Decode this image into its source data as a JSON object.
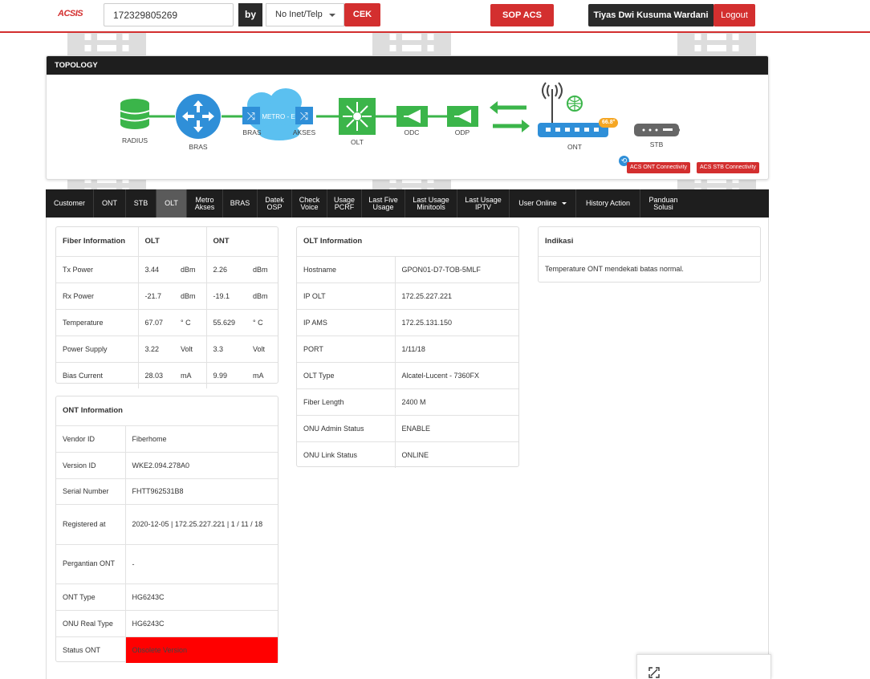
{
  "header": {
    "logo": "ACSIS",
    "search_value": "172329805269",
    "by_label": "by",
    "search_type": "No Inet/Telp",
    "check_button": "CEK",
    "sop_button": "SOP ACS",
    "user_name": "Tiyas Dwi Kusuma Wardani",
    "logout_button": "Logout"
  },
  "topology": {
    "title": "TOPOLOGY",
    "nodes": {
      "radius": "RADIUS",
      "bras": "BRAS",
      "bras_metro": "BRAS",
      "metro": "METRO - E",
      "akses": "AKSES",
      "olt": "OLT",
      "odc": "ODC",
      "odp": "ODP",
      "ont": "ONT",
      "stb": "STB"
    },
    "ont_temperature": "66.8°",
    "acs_ont_button": "ACS ONT Connectivity",
    "acs_stb_button": "ACS STB Connectivity",
    "colors": {
      "green": "#3bb54a",
      "blue": "#2f8fd8",
      "gray": "#666666"
    }
  },
  "tabs": [
    {
      "label": "Customer",
      "active": false
    },
    {
      "label": "ONT",
      "active": false
    },
    {
      "label": "STB",
      "active": false
    },
    {
      "label": "OLT",
      "active": true
    },
    {
      "label": "Metro Akses",
      "active": false
    },
    {
      "label": "BRAS",
      "active": false
    },
    {
      "label": "Datek OSP",
      "active": false
    },
    {
      "label": "Check Voice",
      "active": false
    },
    {
      "label": "Usage PCRF",
      "active": false
    },
    {
      "label": "Last Five Usage",
      "active": false
    },
    {
      "label": "Last Usage Minitools",
      "active": false
    },
    {
      "label": "Last Usage IPTV",
      "active": false
    },
    {
      "label": "User Online",
      "active": false
    },
    {
      "label": "History Action",
      "active": false
    },
    {
      "label": "Panduan Solusi",
      "active": false
    }
  ],
  "fiber_info": {
    "headers": [
      "Fiber Information",
      "OLT",
      "ONT"
    ],
    "rows": [
      {
        "label": "Tx Power",
        "olt": "3.44",
        "olt_unit": "dBm",
        "ont": "2.26",
        "ont_unit": "dBm"
      },
      {
        "label": "Rx Power",
        "olt": "-21.7",
        "olt_unit": "dBm",
        "ont": "-19.1",
        "ont_unit": "dBm"
      },
      {
        "label": "Temperature",
        "olt": "67.07",
        "olt_unit": "° C",
        "ont": "55.629",
        "ont_unit": "° C"
      },
      {
        "label": "Power Supply",
        "olt": "3.22",
        "olt_unit": "Volt",
        "ont": "3.3",
        "ont_unit": "Volt"
      },
      {
        "label": "Bias Current",
        "olt": "28.03",
        "olt_unit": "mA",
        "ont": "9.99",
        "ont_unit": "mA"
      }
    ]
  },
  "ont_info": {
    "title": "ONT Information",
    "rows": [
      {
        "label": "Vendor ID",
        "value": "Fiberhome"
      },
      {
        "label": "Version ID",
        "value": "WKE2.094.278A0"
      },
      {
        "label": "Serial Number",
        "value": "FHTT962531B8"
      },
      {
        "label": "Registered at",
        "value": "2020-12-05 | 172.25.227.221 | 1 / 11 / 18"
      },
      {
        "label": "Pergantian ONT",
        "value": "-"
      },
      {
        "label": "ONT Type",
        "value": "HG6243C"
      },
      {
        "label": "ONU Real Type",
        "value": "HG6243C"
      },
      {
        "label": "Status ONT",
        "value": "Obsolete Version"
      }
    ],
    "status_color": "#ff0000"
  },
  "olt_info": {
    "title": "OLT Information",
    "rows": [
      {
        "label": "Hostname",
        "value": "GPON01-D7-TOB-5MLF"
      },
      {
        "label": "IP OLT",
        "value": "172.25.227.221"
      },
      {
        "label": "IP AMS",
        "value": "172.25.131.150"
      },
      {
        "label": "PORT",
        "value": "1/11/18"
      },
      {
        "label": "OLT Type",
        "value": "Alcatel-Lucent - 7360FX"
      },
      {
        "label": "Fiber Length",
        "value": "2400 M"
      },
      {
        "label": "ONU Admin Status",
        "value": "ENABLE"
      },
      {
        "label": "ONU Link Status",
        "value": "ONLINE"
      }
    ]
  },
  "indikasi": {
    "title": "Indikasi",
    "text": "Temperature ONT mendekati batas normal."
  }
}
